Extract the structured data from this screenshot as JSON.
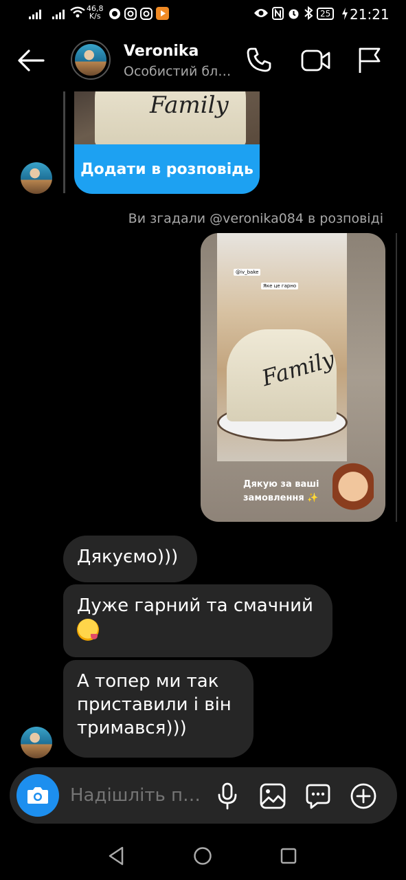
{
  "status_bar": {
    "net_speed_value": "46,8",
    "net_speed_unit": "K/s",
    "battery": "25",
    "time": "21:21"
  },
  "header": {
    "name": "Veronika",
    "subtitle": "Особистий бл…"
  },
  "story_reply": {
    "button_label": "Додати в розповідь"
  },
  "mention": {
    "text": "Ви згадали @veronika084 в розповіді"
  },
  "story_card": {
    "username": "veronika084",
    "tag1": "@iv_bake",
    "tag2": "Яке це гарно",
    "caption_line1": "Дякую за ваші",
    "caption_line2": "замовлення",
    "sparkle": "✨",
    "cake_word": "Family"
  },
  "messages": [
    {
      "text": "Дякуємо)))"
    },
    {
      "text": "Дуже гарний та смачний"
    },
    {
      "line1": "А топер ми так",
      "line2": "приставили і він",
      "line3": "тримався)))"
    }
  ],
  "composer": {
    "placeholder": "Надішліть п…"
  },
  "colors": {
    "accent_blue": "#1da1f2",
    "camera_blue": "#1d8fef",
    "bubble_bg": "#262626",
    "muted_text": "#a8a8a8"
  }
}
